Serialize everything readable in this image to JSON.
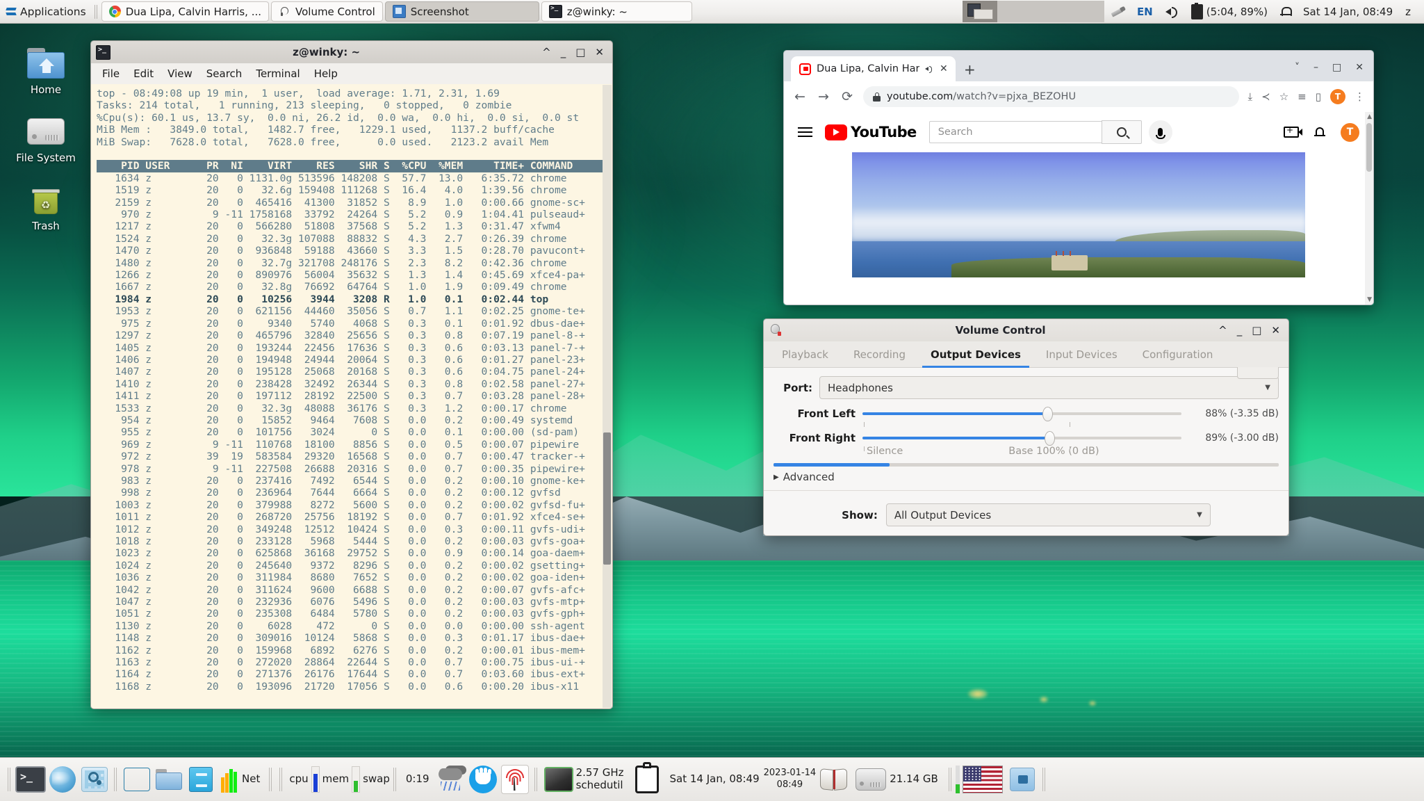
{
  "top_panel": {
    "applications_label": "Applications",
    "windows": [
      {
        "label": "Dua Lipa, Calvin Harris, ...",
        "icon": "chrome-icon",
        "active": false
      },
      {
        "label": "Volume Control",
        "icon": "volume-icon",
        "active": false
      },
      {
        "label": "Screenshot",
        "icon": "screenshot-icon",
        "active": true
      },
      {
        "label": "z@winky: ~",
        "icon": "terminal-icon",
        "active": false
      }
    ],
    "tray": {
      "keyboard_layout": "EN",
      "battery": "(5:04, 89%)",
      "clock": "Sat 14 Jan, 08:49",
      "user": "z"
    }
  },
  "desktop_icons": [
    {
      "label": "Home",
      "icon": "home-folder-icon"
    },
    {
      "label": "File System",
      "icon": "hard-drive-icon"
    },
    {
      "label": "Trash",
      "icon": "trash-icon"
    }
  ],
  "terminal": {
    "title": "z@winky: ~",
    "menu": [
      "File",
      "Edit",
      "View",
      "Search",
      "Terminal",
      "Help"
    ],
    "summary": {
      "line1": "top - 08:49:08 up 19 min,  1 user,  load average: 1.71, 2.31, 1.69",
      "line2": "Tasks: 214 total,   1 running, 213 sleeping,   0 stopped,   0 zombie",
      "line3": "%Cpu(s): 60.1 us, 13.7 sy,  0.0 ni, 26.2 id,  0.0 wa,  0.0 hi,  0.0 si,  0.0 st",
      "line4": "MiB Mem :   3849.0 total,   1482.7 free,   1229.1 used,   1137.2 buff/cache",
      "line5": "MiB Swap:   7628.0 total,   7628.0 free,      0.0 used.   2123.2 avail Mem"
    },
    "header": "    PID USER      PR  NI    VIRT    RES    SHR S  %CPU  %MEM     TIME+ COMMAND",
    "rows": [
      "   1634 z         20   0 1131.0g 513596 148208 S  57.7  13.0   6:35.72 chrome",
      "   1519 z         20   0   32.6g 159408 111268 S  16.4   4.0   1:39.56 chrome",
      "   2159 z         20   0  465416  41300  31852 S   8.9   1.0   0:00.66 gnome-sc+",
      "    970 z          9 -11 1758168  33792  24264 S   5.2   0.9   1:04.41 pulseaud+",
      "   1217 z         20   0  566280  51808  37568 S   5.2   1.3   0:31.47 xfwm4",
      "   1524 z         20   0   32.3g 107088  88832 S   4.3   2.7   0:26.39 chrome",
      "   1470 z         20   0  936848  59188  43660 S   3.3   1.5   0:28.70 pavucont+",
      "   1480 z         20   0   32.7g 321708 248176 S   2.3   8.2   0:42.36 chrome",
      "   1266 z         20   0  890976  56004  35632 S   1.3   1.4   0:45.69 xfce4-pa+",
      "   1667 z         20   0   32.8g  76692  64764 S   1.0   1.9   0:09.49 chrome",
      "   1984 z         20   0   10256   3944   3208 R   1.0   0.1   0:02.44 top",
      "   1953 z         20   0  621156  44460  35056 S   0.7   1.1   0:02.25 gnome-te+",
      "    975 z         20   0    9340   5740   4068 S   0.3   0.1   0:01.92 dbus-dae+",
      "   1297 z         20   0  465796  32840  25656 S   0.3   0.8   0:07.19 panel-8-+",
      "   1405 z         20   0  193244  22456  17636 S   0.3   0.6   0:03.13 panel-7-+",
      "   1406 z         20   0  194948  24944  20064 S   0.3   0.6   0:01.27 panel-23+",
      "   1407 z         20   0  195128  25068  20168 S   0.3   0.6   0:04.75 panel-24+",
      "   1410 z         20   0  238428  32492  26344 S   0.3   0.8   0:02.58 panel-27+",
      "   1411 z         20   0  197112  28192  22500 S   0.3   0.7   0:03.28 panel-28+",
      "   1533 z         20   0   32.3g  48088  36176 S   0.3   1.2   0:00.17 chrome",
      "    954 z         20   0   15852   9464   7608 S   0.0   0.2   0:00.49 systemd",
      "    955 z         20   0  101756   3024      0 S   0.0   0.1   0:00.00 (sd-pam)",
      "    969 z          9 -11  110768  18100   8856 S   0.0   0.5   0:00.07 pipewire",
      "    972 z         39  19  583584  29320  16568 S   0.0   0.7   0:00.47 tracker-+",
      "    978 z          9 -11  227508  26688  20316 S   0.0   0.7   0:00.35 pipewire+",
      "    983 z         20   0  237416   7492   6544 S   0.0   0.2   0:00.10 gnome-ke+",
      "    998 z         20   0  236964   7644   6664 S   0.0   0.2   0:00.12 gvfsd",
      "   1003 z         20   0  379988   8272   5600 S   0.0   0.2   0:00.02 gvfsd-fu+",
      "   1011 z         20   0  268720  25756  18192 S   0.0   0.7   0:01.92 xfce4-se+",
      "   1012 z         20   0  349248  12512  10424 S   0.0   0.3   0:00.11 gvfs-udi+",
      "   1018 z         20   0  233128   5968   5444 S   0.0   0.2   0:00.03 gvfs-goa+",
      "   1023 z         20   0  625868  36168  29752 S   0.0   0.9   0:00.14 goa-daem+",
      "   1024 z         20   0  245640   9372   8296 S   0.0   0.2   0:00.02 gsetting+",
      "   1036 z         20   0  311984   8680   7652 S   0.0   0.2   0:00.02 goa-iden+",
      "   1042 z         20   0  311624   9600   6688 S   0.0   0.2   0:00.07 gvfs-afc+",
      "   1047 z         20   0  232936   6076   5496 S   0.0   0.2   0:00.03 gvfs-mtp+",
      "   1051 z         20   0  235308   6484   5780 S   0.0   0.2   0:00.03 gvfs-gph+",
      "   1130 z         20   0    6028    472      0 S   0.0   0.0   0:00.00 ssh-agent",
      "   1148 z         20   0  309016  10124   5868 S   0.0   0.3   0:01.17 ibus-dae+",
      "   1162 z         20   0  159968   6892   6276 S   0.0   0.2   0:00.01 ibus-mem+",
      "   1163 z         20   0  272020  28864  22644 S   0.0   0.7   0:00.75 ibus-ui-+",
      "   1164 z         20   0  271376  26176  17644 S   0.0   0.7   0:03.60 ibus-ext+",
      "   1168 z         20   0  193096  21720  17056 S   0.0   0.6   0:00.20 ibus-x11"
    ],
    "selected_row_index": 10
  },
  "chrome": {
    "tab": {
      "title": "Dua Lipa, Calvin Harris,",
      "close": "✕"
    },
    "newtab": "+",
    "url_protocol_domain": "youtube.com",
    "url_path": "/watch?v=pjxa_BEZOHU",
    "avatar_initial": "T",
    "youtube": {
      "logo_text": "YouTube",
      "search_placeholder": "Search",
      "avatar_initial": "T"
    }
  },
  "volume_control": {
    "title": "Volume Control",
    "tabs": [
      {
        "label": "Playback",
        "selected": false
      },
      {
        "label": "Recording",
        "selected": false
      },
      {
        "label": "Output Devices",
        "selected": true
      },
      {
        "label": "Input Devices",
        "selected": false
      },
      {
        "label": "Configuration",
        "selected": false
      }
    ],
    "port_label": "Port:",
    "port_value": "Headphones",
    "channels": [
      {
        "name": "Front Left",
        "value": "88% (-3.35 dB)",
        "percent": 88
      },
      {
        "name": "Front Right",
        "value": "89% (-3.00 dB)",
        "percent": 89
      }
    ],
    "scale_left": "Silence",
    "scale_base": "Base 100% (0 dB)",
    "peak_percent": 23,
    "advanced_label": "Advanced",
    "show_label": "Show:",
    "show_value": "All Output Devices"
  },
  "dock": {
    "net_label": "Net",
    "cpu_label": "cpu",
    "mem_label": "mem",
    "swap_label": "swap",
    "uptime": "0:19",
    "cpu_freq": "2.57 GHz",
    "cpu_gov": "schedutil",
    "clock": "Sat 14 Jan, 08:49",
    "date_stamp": "2023-01-14",
    "time_stamp": "08:49",
    "disk_free": "21.14 GB"
  }
}
